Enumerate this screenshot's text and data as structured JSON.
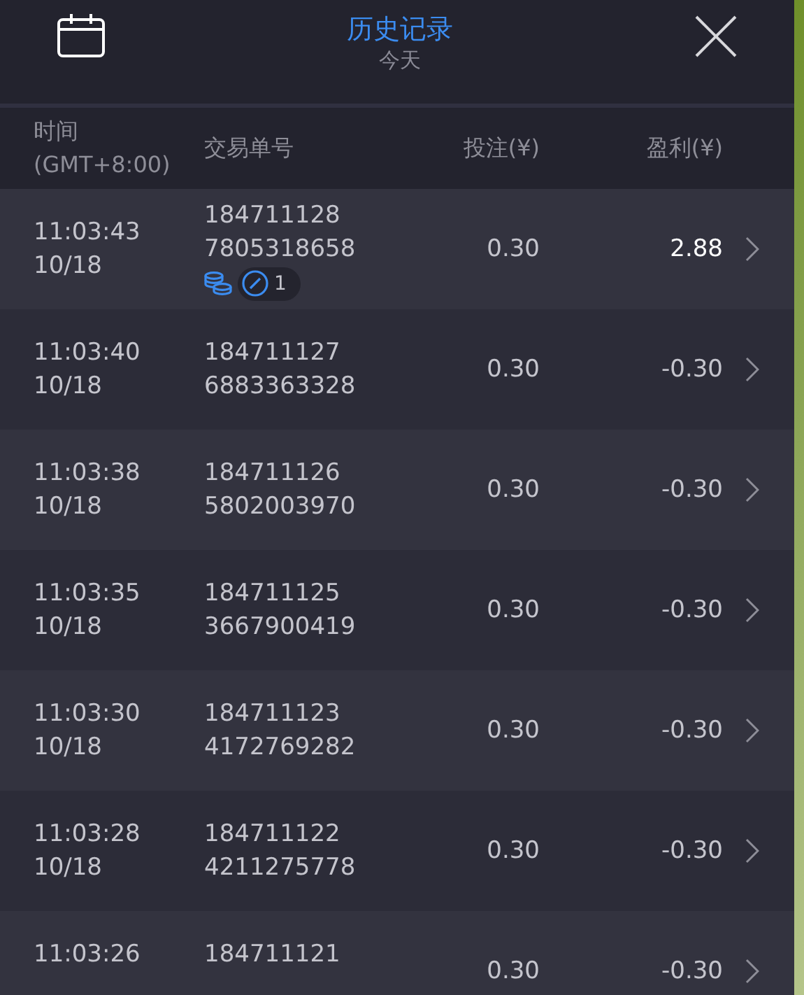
{
  "header": {
    "title": "历史记录",
    "subtitle": "今天"
  },
  "columns": [
    {
      "lines": [
        "时间",
        "(GMT+8:00)"
      ]
    },
    {
      "lines": [
        "交易单号"
      ]
    },
    {
      "lines": [
        "投注(¥)"
      ]
    },
    {
      "lines": [
        "盈利(¥)"
      ]
    }
  ],
  "rows": [
    {
      "time": "11:03:43",
      "date": "10/18",
      "order": [
        "184711128",
        "7805318658"
      ],
      "badge": {
        "count": "1"
      },
      "stake": "0.30",
      "profit": "2.88",
      "positive": true
    },
    {
      "time": "11:03:40",
      "date": "10/18",
      "order": [
        "184711127",
        "6883363328"
      ],
      "stake": "0.30",
      "profit": "-0.30",
      "positive": false
    },
    {
      "time": "11:03:38",
      "date": "10/18",
      "order": [
        "184711126",
        "5802003970"
      ],
      "stake": "0.30",
      "profit": "-0.30",
      "positive": false
    },
    {
      "time": "11:03:35",
      "date": "10/18",
      "order": [
        "184711125",
        "3667900419"
      ],
      "stake": "0.30",
      "profit": "-0.30",
      "positive": false
    },
    {
      "time": "11:03:30",
      "date": "10/18",
      "order": [
        "184711123",
        "4172769282"
      ],
      "stake": "0.30",
      "profit": "-0.30",
      "positive": false
    },
    {
      "time": "11:03:28",
      "date": "10/18",
      "order": [
        "184711122",
        "4211275778"
      ],
      "stake": "0.30",
      "profit": "-0.30",
      "positive": false
    },
    {
      "time": "11:03:26",
      "order": [
        "184711121"
      ],
      "stake": "0.30",
      "profit": "-0.30",
      "positive": false
    }
  ]
}
